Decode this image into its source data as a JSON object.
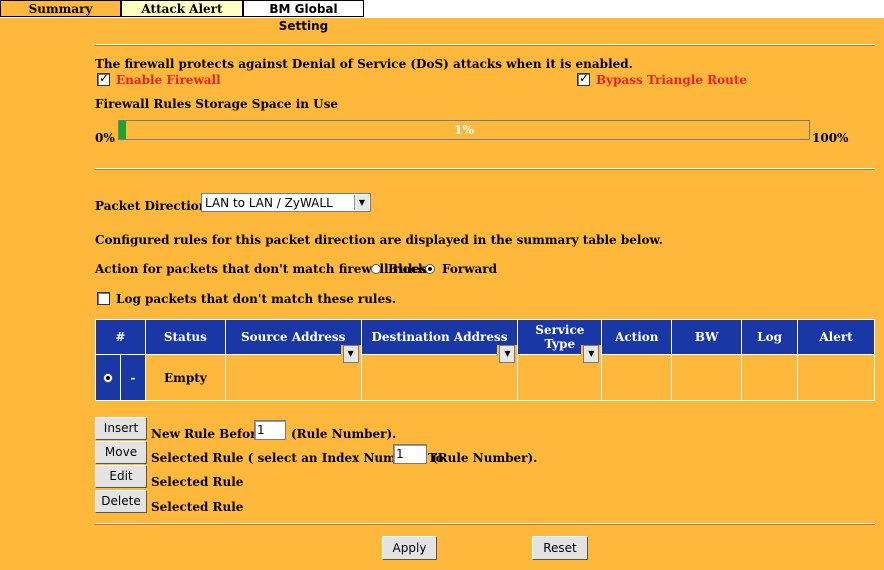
{
  "tabs": [
    {
      "label": "Summary"
    },
    {
      "label": "Attack Alert"
    },
    {
      "label": "BM Global Setting"
    }
  ],
  "intro_text": "The firewall protects against Denial of Service (DoS) attacks when it is enabled.",
  "enable_firewall": {
    "label": "Enable Firewall",
    "checked": true
  },
  "bypass_triangle": {
    "label": "Bypass Triangle Route",
    "checked": true
  },
  "storage": {
    "label": "Firewall Rules Storage Space in Use",
    "min_label": "0%",
    "max_label": "100%",
    "value_label": "1%",
    "fraction": 0.01,
    "fill_color": "#1EA32C"
  },
  "packet_direction": {
    "label": "Packet Direction:",
    "selected": "LAN to LAN / ZyWALL"
  },
  "configured_text": "Configured rules for this packet direction are displayed in the summary table below.",
  "action": {
    "label": "Action for packets that don't match firewall rules.",
    "block_label": "Block",
    "forward_label": "Forward",
    "selected": "Forward"
  },
  "log_packets": {
    "label": "Log packets that don't match these rules.",
    "checked": false
  },
  "table": {
    "headers": [
      "#",
      "Status",
      "Source Address",
      "Destination Address",
      "Service Type",
      "Action",
      "BW",
      "Log",
      "Alert"
    ],
    "header_color": "#1A38A5",
    "rows": [
      {
        "index": "-",
        "status": "Empty",
        "source": "",
        "destination": "",
        "service": "",
        "action": "",
        "bw": "",
        "log": "",
        "alert": ""
      }
    ]
  },
  "insert": {
    "button": "Insert",
    "text_before": "New Rule Before",
    "value": "1",
    "text_after": "(Rule Number)."
  },
  "move": {
    "button": "Move",
    "text_before": "Selected Rule ( select an Index Number) To",
    "value": "1",
    "text_after": "(Rule Number)."
  },
  "edit": {
    "button": "Edit",
    "text": "Selected Rule"
  },
  "delete": {
    "button": "Delete",
    "text": "Selected Rule"
  },
  "apply_label": "Apply",
  "reset_label": "Reset",
  "colors": {
    "background": "#FEB93D",
    "accent_red": "#E8222A"
  }
}
